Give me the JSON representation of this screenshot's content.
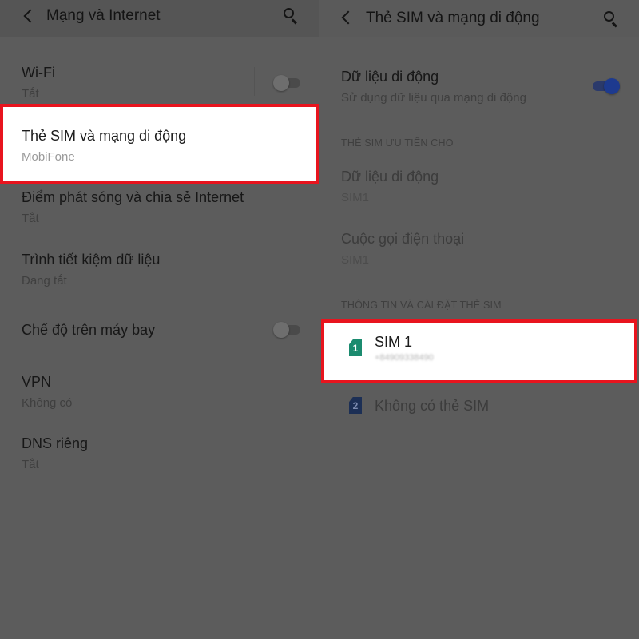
{
  "left": {
    "title": "Mạng và Internet",
    "items": [
      {
        "title": "Wi-Fi",
        "subtitle": "Tắt"
      },
      {
        "title": "Thẻ SIM và mạng di động",
        "subtitle": "MobiFone"
      },
      {
        "title": "Điểm phát sóng và chia sẻ Internet",
        "subtitle": "Tắt"
      },
      {
        "title": "Trình tiết kiệm dữ liệu",
        "subtitle": "Đang tắt"
      },
      {
        "title": "Chế độ trên máy bay"
      },
      {
        "title": "VPN",
        "subtitle": "Không có"
      },
      {
        "title": "DNS riêng",
        "subtitle": "Tắt"
      }
    ],
    "toggles": {
      "wifi": false,
      "airplane": false
    }
  },
  "right": {
    "title": "Thẻ SIM và mạng di động",
    "mobile_data": {
      "title": "Dữ liệu di động",
      "subtitle": "Sử dụng dữ liệu qua mạng di động",
      "enabled": true
    },
    "preferred_section": "THẺ SIM ƯU TIÊN CHO",
    "preferred_items": [
      {
        "title": "Dữ liệu di động",
        "subtitle": "SIM1"
      },
      {
        "title": "Cuộc gọi điện thoại",
        "subtitle": "SIM1"
      }
    ],
    "info_section": "THÔNG TIN VÀ CÀI ĐẶT THẺ SIM",
    "sims": [
      {
        "badge": "1",
        "title": "SIM 1",
        "subtitle": "+84909338490"
      },
      {
        "badge": "2",
        "title": "Không có thẻ SIM"
      }
    ]
  },
  "colors": {
    "highlight_border": "#e8141e",
    "toggle_on": "#1d3a8f",
    "sim1_badge": "#1b8b6f",
    "overlay": "#5c5c5c"
  },
  "icons": {
    "back": "arrow-back-icon",
    "search": "search-icon",
    "sim": "sim-card-icon"
  }
}
